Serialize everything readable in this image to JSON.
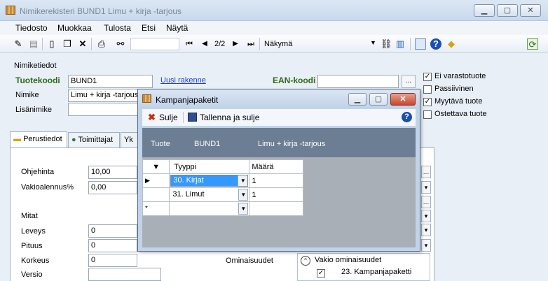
{
  "window": {
    "title": "Nimikerekisteri BUND1 Limu + kirja -tarjous"
  },
  "menu": [
    "Tiedosto",
    "Muokkaa",
    "Tulosta",
    "Etsi",
    "Näytä"
  ],
  "toolbar": {
    "record_position": "2/2",
    "view_label": "Näkymä"
  },
  "header": {
    "section": "Nimiketiedot",
    "code_label": "Tuotekoodi",
    "code_value": "BUND1",
    "new_structure_link": "Uusi rakenne",
    "ean_label": "EAN-koodi",
    "ean_button": "...",
    "name_label": "Nimike",
    "name_value": "Limu + kirja -tarjous",
    "extra_name_label": "Lisänimike"
  },
  "flags": [
    {
      "label": "Ei varastotuote",
      "checked": true
    },
    {
      "label": "Passiivinen",
      "checked": false
    },
    {
      "label": "Myytävä tuote",
      "checked": true
    },
    {
      "label": "Ostettava tuote",
      "checked": false
    }
  ],
  "tabs": [
    "Perustiedot",
    "Toimittajat",
    "Yk"
  ],
  "basic": {
    "price_label": "Ohjehinta",
    "price_value": "10,00",
    "discount_label": "Vakioalennus%",
    "discount_value": "0,00",
    "dims_label": "Mitat",
    "width_label": "Leveys",
    "width_value": "0",
    "length_label": "Pituus",
    "length_value": "0",
    "height_label": "Korkeus",
    "height_value": "0",
    "version_label": "Versio"
  },
  "properties": {
    "label": "Ominaisuudet",
    "group": "Vakio ominaisuudet",
    "item": "23. Kampanjapaketti"
  },
  "dialog": {
    "title": "Kampanjapaketit",
    "close_label": "Sulje",
    "save_close_label": "Tallenna ja sulje",
    "product_label": "Tuote",
    "product_code": "BUND1",
    "product_name": "Limu + kirja -tarjous",
    "columns": [
      "Tyyppi",
      "Määrä"
    ],
    "rows": [
      {
        "type": "30. Kirjat",
        "qty": "1"
      },
      {
        "type": "31. Limut",
        "qty": "1"
      }
    ],
    "new_row_marker": "*"
  }
}
